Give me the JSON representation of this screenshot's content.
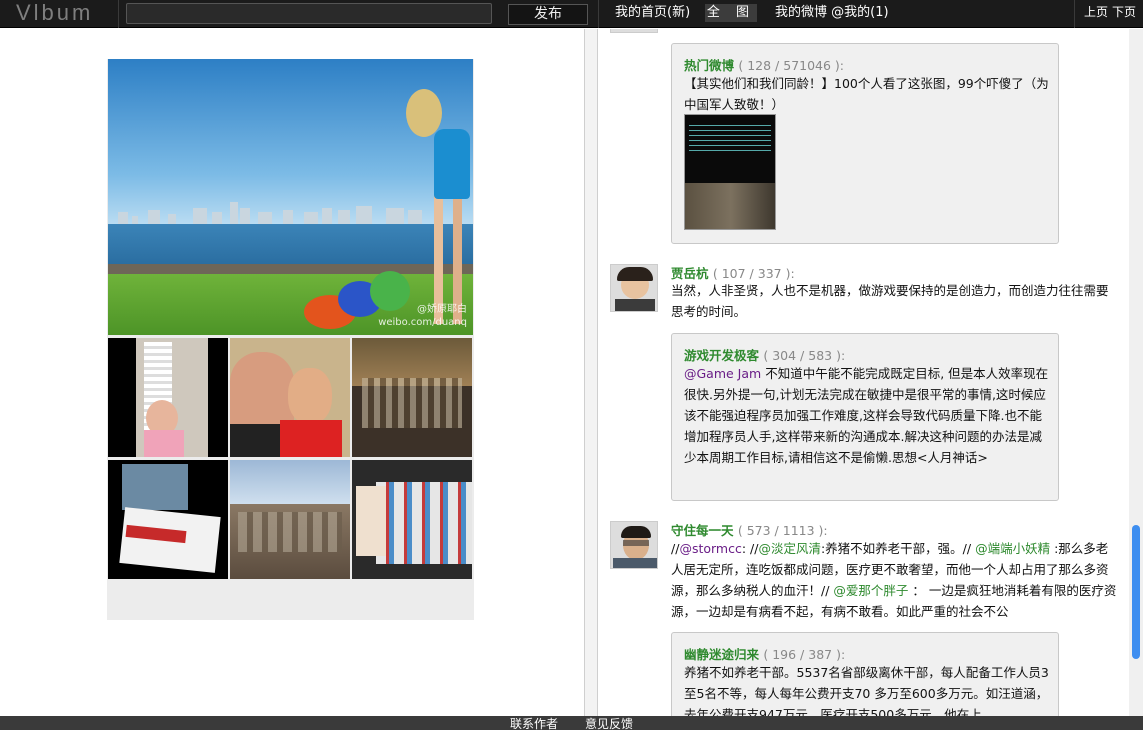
{
  "topbar": {
    "logo": "Vlbum",
    "post_button": "发布",
    "nav_home": "我的首页(新)",
    "nav_all": "全 图",
    "nav_mine": "我的微博 @我的(1)",
    "prev_page": "上页",
    "next_page": "下页"
  },
  "album": {
    "watermark_line1": "@娇原耶白",
    "watermark_line2": "weibo.com/duanq"
  },
  "posts": [
    {
      "quote": {
        "author": "热门微博",
        "meta": "( 128 / 571046 ):",
        "text": "【其实他们和我们同龄！】100个人看了这张图，99个吓傻了（为中国军人致敬！）"
      }
    },
    {
      "author": "贾岳杭",
      "meta": "( 107 / 337 ):",
      "text": "当然，人非圣贤，人也不是机器，做游戏要保持的是创造力，而创造力往往需要思考的时间。",
      "quote": {
        "author": "游戏开发极客",
        "meta": "( 304 / 583 ):",
        "mention": "@Game Jam",
        "text": " 不知道中午能不能完成既定目标, 但是本人效率现在很快.另外提一句,计划无法完成在敏捷中是很平常的事情,这时候应该不能强迫程序员加强工作难度,这样会导致代码质量下降.也不能增加程序员人手,这样带来新的沟通成本.解决这种问题的办法是减少本周期工作目标,请相信这不是偷懒.思想<人月神话>"
      }
    },
    {
      "author": "守住每一天",
      "meta": "( 573 / 1113 ):",
      "text_parts": [
        "//",
        "@stormcc",
        ": //",
        "@淡定风清",
        ":养猪不如养老干部，强。// ",
        "@端端小妖精",
        " :那么多老人居无定所，连吃饭都成问题，医疗更不敢奢望，而他一个人却占用了那么多资源，那么多纳税人的血汗！// ",
        "@爱那个胖子",
        " ： 一边是疯狂地消耗着有限的医疗资源，一边却是有病看不起，有病不敢看。如此严重的社会不公"
      ],
      "quote": {
        "author": "幽静迷途归来",
        "meta": "( 196 / 387 ):",
        "text": "养猪不如养老干部。5537名省部级离休干部，每人配备工作人员3至5名不等，每人每年公费开支70 多万至600多万元。如汪道涵，去年公费开支947万元，医疗开支500多万元，他在上"
      }
    }
  ],
  "footer": {
    "contact": "联系作者",
    "feedback": "意见反馈"
  }
}
